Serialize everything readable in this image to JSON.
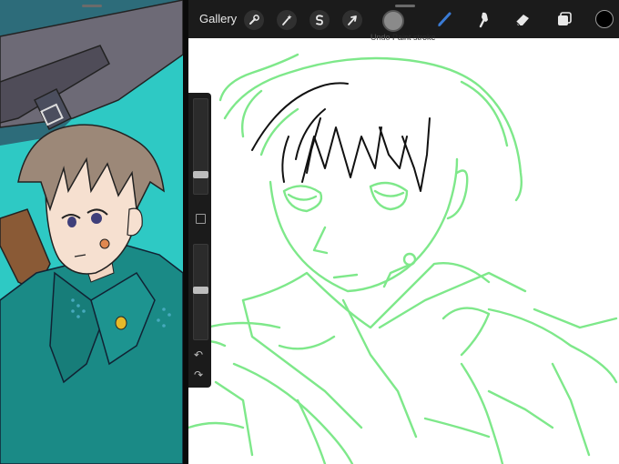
{
  "toolbar": {
    "gallery_label": "Gallery",
    "actions_icon": "wrench-icon",
    "adjustments_icon": "magic-wand-icon",
    "selection_icon": "selection-s-icon",
    "transform_icon": "arrow-cursor-icon",
    "brush_preview_icon": "brush-preview-circle",
    "paint_icon": "brush-icon",
    "smudge_icon": "smudge-finger-icon",
    "eraser_icon": "eraser-icon",
    "layers_icon": "layers-icon",
    "color_icon": "color-swatch-icon",
    "current_color": "#000000"
  },
  "toast": {
    "prefix": "Undo",
    "action": "Paint stroke"
  },
  "sidebar": {
    "modify_icon": "modify-square-icon",
    "undo_icon": "undo-arrow-icon",
    "redo_icon": "redo-arrow-icon"
  },
  "colors": {
    "sketch_green": "#7ee88a",
    "ink": "#111111",
    "ref_background": "#2ec9c4",
    "ref_coat": "#1a8a86",
    "toolbar_bg": "#1b1b1b",
    "accent_blue": "#3a7bd5"
  }
}
